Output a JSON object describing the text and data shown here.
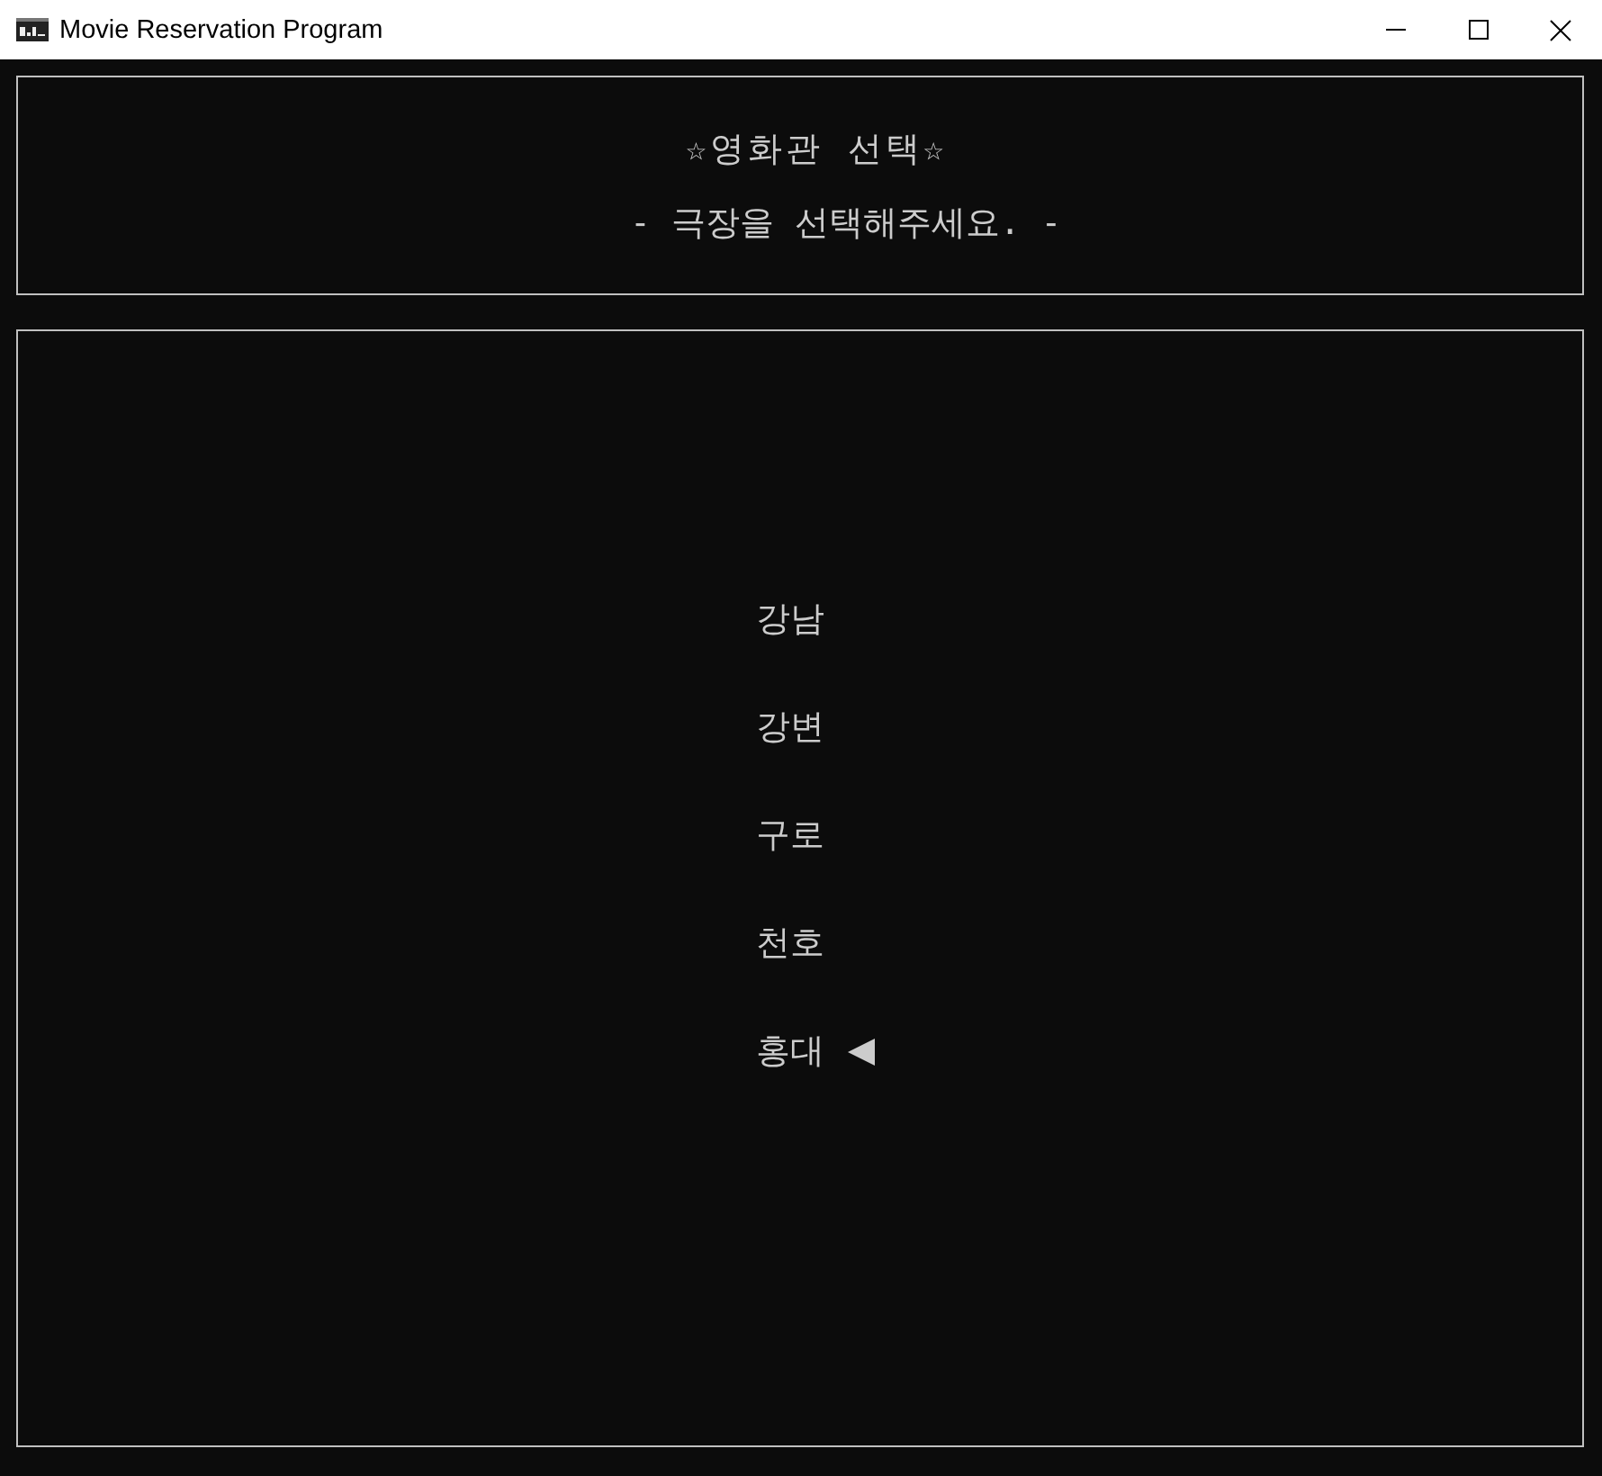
{
  "window": {
    "title": "Movie Reservation Program"
  },
  "header": {
    "title": "☆영화관 선택☆",
    "subtitle": "- 극장을 선택해주세요. -"
  },
  "theaters": [
    {
      "label": "강남",
      "selected": false
    },
    {
      "label": "강변",
      "selected": false
    },
    {
      "label": "구로",
      "selected": false
    },
    {
      "label": "천호",
      "selected": false
    },
    {
      "label": "홍대",
      "selected": true
    }
  ]
}
